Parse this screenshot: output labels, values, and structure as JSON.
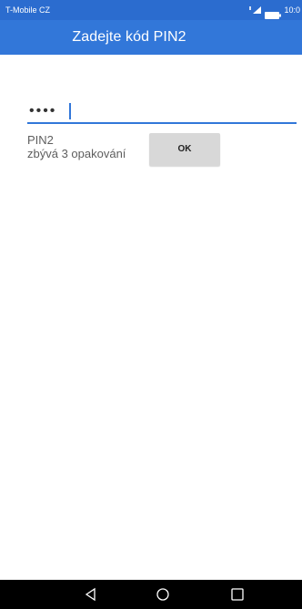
{
  "status_bar": {
    "carrier": "T-Mobile CZ",
    "time": "10:0",
    "icons": [
      "signal-icon",
      "battery-icon"
    ]
  },
  "app_bar": {
    "title": "Zadejte kód PIN2"
  },
  "pin_input": {
    "value": "••••"
  },
  "info": {
    "label": "PIN2",
    "remaining": "zbývá 3 opakování"
  },
  "ok_button": {
    "label": "OK"
  },
  "nav_bar": {
    "icons": [
      "back-icon",
      "home-icon",
      "recent-apps-icon"
    ]
  },
  "colors": {
    "status_bar": "#2b6ccf",
    "app_bar": "#3277d9",
    "accent": "#3277d9",
    "button": "#d8d8d8",
    "nav_bar": "#000000"
  }
}
